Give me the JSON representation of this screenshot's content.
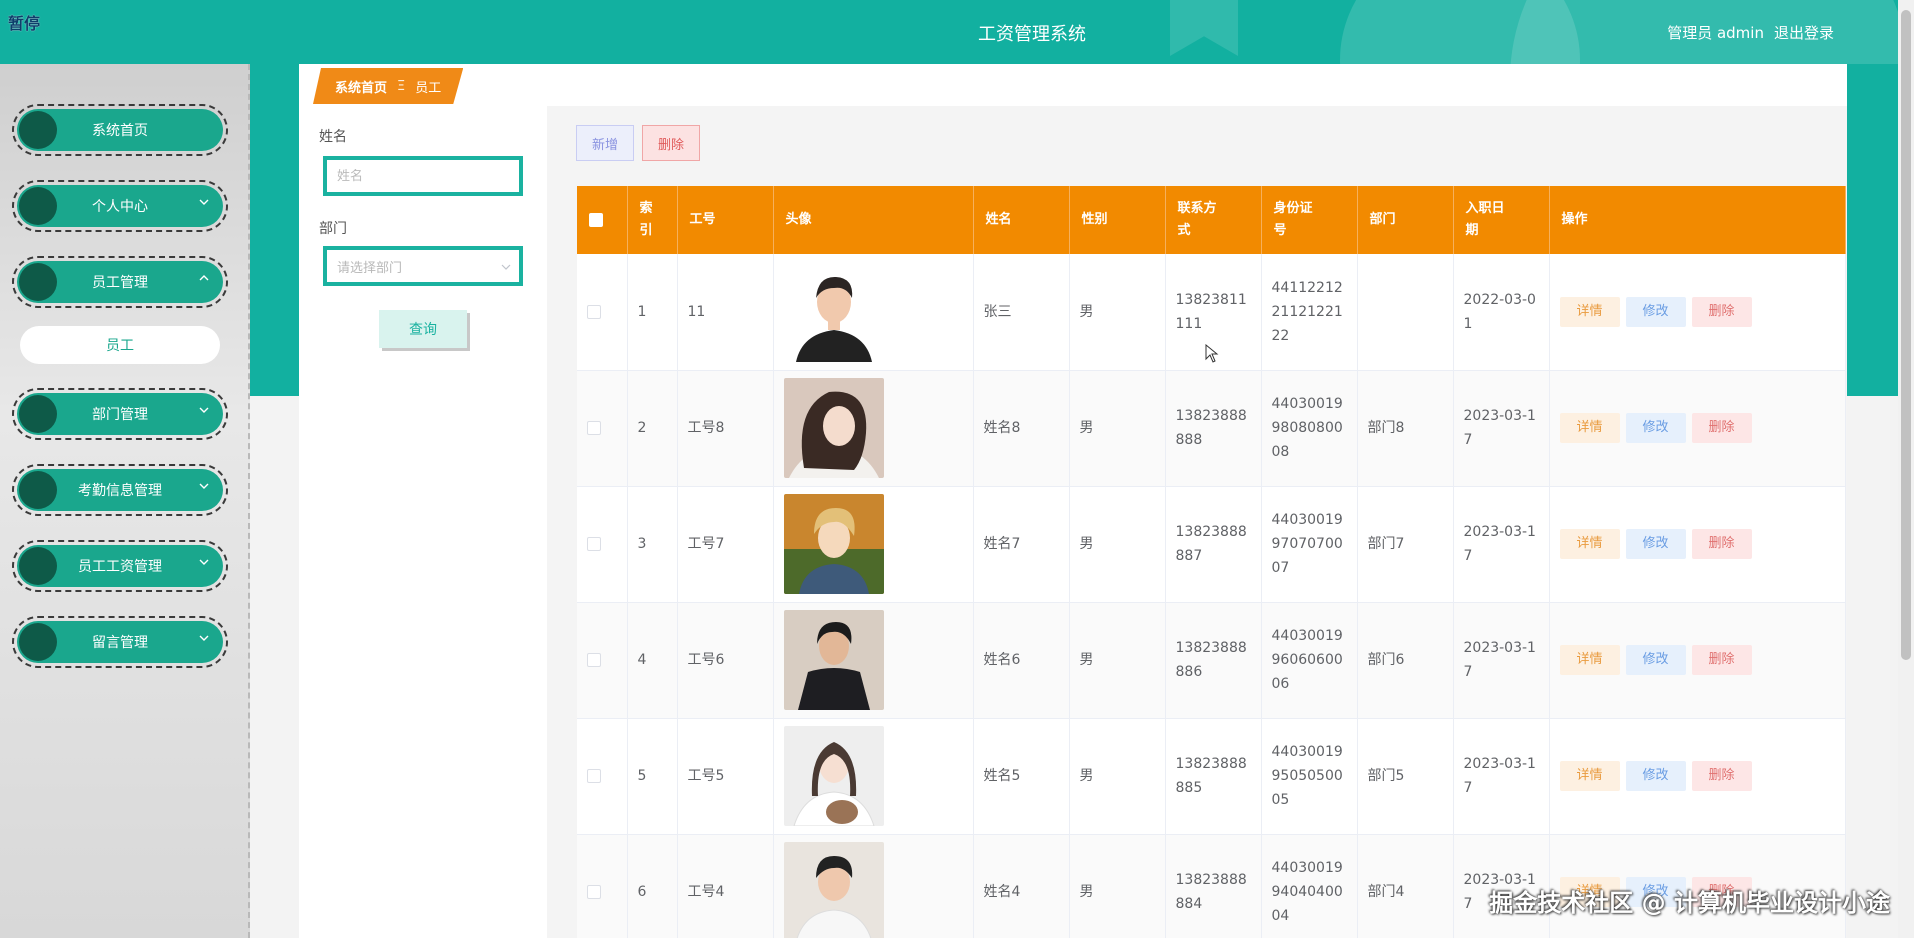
{
  "overlay": {
    "pause_label": "暂停",
    "watermark": "掘金技术社区 @ 计算机毕业设计小途"
  },
  "header": {
    "title": "工资管理系统",
    "user_label": "管理员 admin",
    "logout_label": "退出登录"
  },
  "sidebar": {
    "items": [
      {
        "label": "系统首页",
        "has_chevron": false
      },
      {
        "label": "个人中心",
        "has_chevron": true,
        "chevron": "chevron-down-icon"
      },
      {
        "label": "员工管理",
        "has_chevron": true,
        "chevron": "chevron-up-icon",
        "expanded": true
      },
      {
        "label": "部门管理",
        "has_chevron": true,
        "chevron": "chevron-down-icon"
      },
      {
        "label": "考勤信息管理",
        "has_chevron": true,
        "chevron": "chevron-down-icon"
      },
      {
        "label": "员工工资管理",
        "has_chevron": true,
        "chevron": "chevron-down-icon"
      },
      {
        "label": "留言管理",
        "has_chevron": true,
        "chevron": "chevron-down-icon"
      }
    ],
    "submenu": {
      "label": "员工"
    }
  },
  "breadcrumb": {
    "home": "系统首页",
    "separator": "Ξ",
    "current": "员工"
  },
  "search": {
    "name_label": "姓名",
    "name_placeholder": "姓名",
    "dept_label": "部门",
    "dept_placeholder": "请选择部门",
    "query_button": "查询"
  },
  "toolbar": {
    "add_label": "新增",
    "delete_label": "删除"
  },
  "table": {
    "columns": [
      "索引",
      "工号",
      "头像",
      "姓名",
      "性别",
      "联系方式",
      "身份证号",
      "部门",
      "入职日期",
      "操作"
    ],
    "column_display": {
      "index": "索\n引",
      "phone": "联系方\n式",
      "id_card": "身份证\n号",
      "hire_date": "入职日\n期"
    },
    "actions": {
      "detail": "详情",
      "edit": "修改",
      "delete": "删除"
    },
    "rows": [
      {
        "index": "1",
        "emp_no": "11",
        "name": "张三",
        "gender": "男",
        "phone": "13823811111",
        "id_card": "441122122112122122",
        "dept": "",
        "hire_date": "2022-03-01"
      },
      {
        "index": "2",
        "emp_no": "工号8",
        "name": "姓名8",
        "gender": "男",
        "phone": "13823888888",
        "id_card": "440300199808080008",
        "dept": "部门8",
        "hire_date": "2023-03-17"
      },
      {
        "index": "3",
        "emp_no": "工号7",
        "name": "姓名7",
        "gender": "男",
        "phone": "13823888887",
        "id_card": "440300199707070007",
        "dept": "部门7",
        "hire_date": "2023-03-17"
      },
      {
        "index": "4",
        "emp_no": "工号6",
        "name": "姓名6",
        "gender": "男",
        "phone": "13823888886",
        "id_card": "440300199606060006",
        "dept": "部门6",
        "hire_date": "2023-03-17"
      },
      {
        "index": "5",
        "emp_no": "工号5",
        "name": "姓名5",
        "gender": "男",
        "phone": "13823888885",
        "id_card": "440300199505050005",
        "dept": "部门5",
        "hire_date": "2023-03-17"
      },
      {
        "index": "6",
        "emp_no": "工号4",
        "name": "姓名4",
        "gender": "男",
        "phone": "13823888884",
        "id_card": "440300199404040004",
        "dept": "部门4",
        "hire_date": "2023-03-17"
      }
    ]
  },
  "colors": {
    "primary": "#12b0a0",
    "menu_pill": "#1aa78d",
    "table_header": "#f28a00"
  }
}
